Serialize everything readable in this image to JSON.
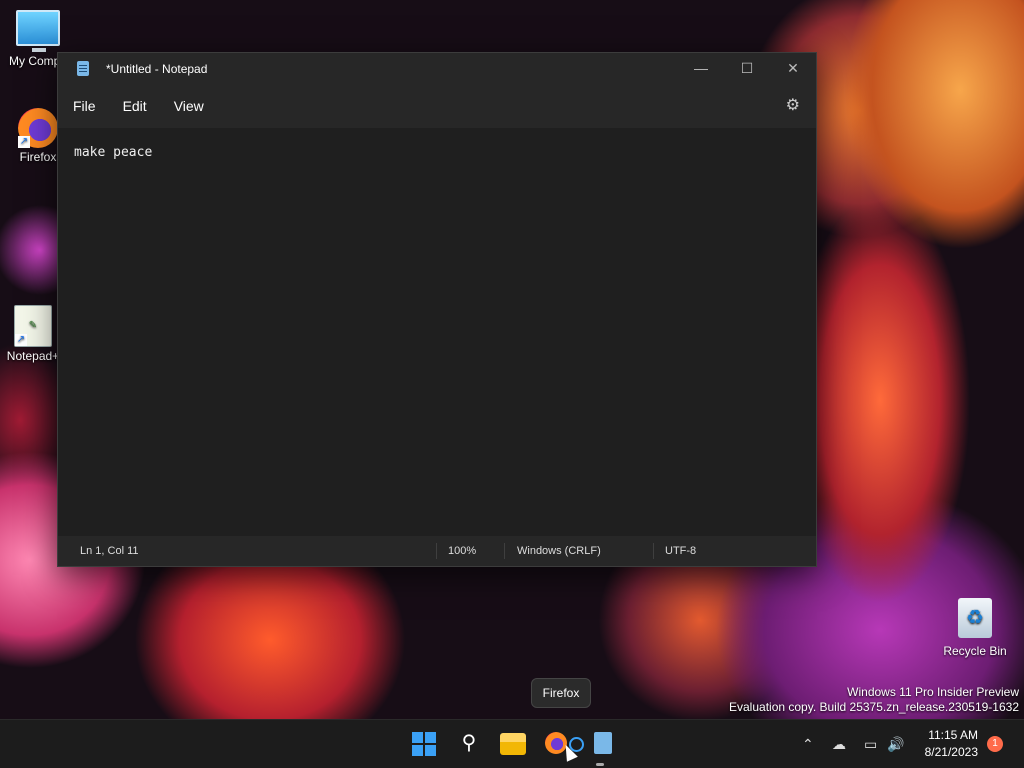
{
  "desktop": {
    "icons": [
      {
        "label": "My Compu",
        "icon": "computer-icon"
      },
      {
        "label": "Firefox",
        "icon": "firefox-icon"
      },
      {
        "label": "Notepad+",
        "icon": "notepadpp-icon"
      },
      {
        "label": "Recycle Bin",
        "icon": "recycle-bin-icon"
      }
    ],
    "watermark": {
      "line1": "Windows 11 Pro Insider Preview",
      "line2": "Evaluation copy. Build 25375.zn_release.230519-1632"
    }
  },
  "window": {
    "title": "*Untitled - Notepad",
    "controls": {
      "minimize": "—",
      "maximize": "☐",
      "close": "✕"
    },
    "menu": {
      "file": "File",
      "edit": "Edit",
      "view": "View"
    },
    "content": "make peace",
    "status": {
      "position": "Ln 1, Col 11",
      "zoom": "100%",
      "line_ending": "Windows (CRLF)",
      "encoding": "UTF-8"
    }
  },
  "taskbar": {
    "tooltip": "Firefox",
    "clock": {
      "time": "11:15 AM",
      "date": "8/21/2023"
    },
    "notification_count": "1",
    "tray": {
      "chevron": "⌃",
      "sound": "🔊"
    }
  },
  "colors": {
    "accent": "#3aa0f5",
    "editor_bg": "#1f1f1f",
    "window_bg": "#272727",
    "taskbar_bg": "#1c1c1c"
  }
}
